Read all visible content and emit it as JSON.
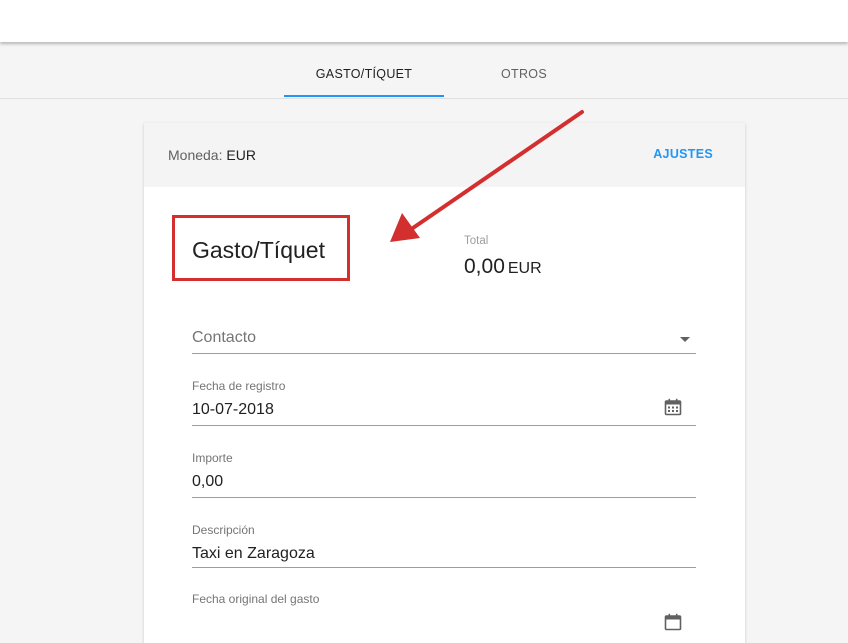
{
  "tabs": [
    {
      "label": "GASTO/TÍQUET"
    },
    {
      "label": "OTROS"
    }
  ],
  "header": {
    "moneda_label": "Moneda:",
    "moneda_value": "EUR",
    "ajustes": "AJUSTES"
  },
  "doc": {
    "title": "Gasto/Tíquet",
    "total_label": "Total",
    "total_value": "0,00",
    "total_currency": "EUR"
  },
  "fields": {
    "contacto_placeholder": "Contacto",
    "fecha_registro_label": "Fecha de registro",
    "fecha_registro_value": "10-07-2018",
    "importe_label": "Importe",
    "importe_value": "0,00",
    "descripcion_label": "Descripción",
    "descripcion_value": "Taxi en Zaragoza",
    "fecha_original_label": "Fecha original del gasto"
  },
  "colors": {
    "accent": "#2196f3",
    "annotation": "#d32f2f"
  },
  "icons": [
    "calendar-icon",
    "dropdown-caret-icon",
    "annotation-arrow-icon"
  ]
}
